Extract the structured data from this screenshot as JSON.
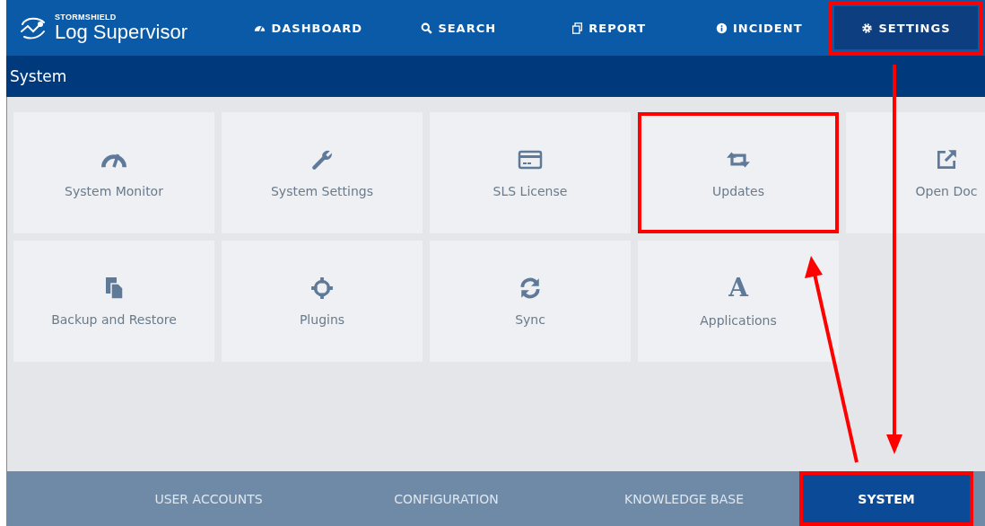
{
  "logo": {
    "brand": "STORMSHIELD",
    "product": "Log Supervisor"
  },
  "nav": [
    {
      "label": "DASHBOARD",
      "selected": false,
      "highlighted": false
    },
    {
      "label": "SEARCH",
      "selected": false,
      "highlighted": false
    },
    {
      "label": "REPORT",
      "selected": false,
      "highlighted": false
    },
    {
      "label": "INCIDENT",
      "selected": false,
      "highlighted": false
    },
    {
      "label": "SETTINGS",
      "selected": true,
      "highlighted": true
    }
  ],
  "section_title": "System",
  "tiles": [
    {
      "label": "System Monitor",
      "highlighted": false
    },
    {
      "label": "System Settings",
      "highlighted": false
    },
    {
      "label": "SLS License",
      "highlighted": false
    },
    {
      "label": "Updates",
      "highlighted": true
    },
    {
      "label": "Open Doc",
      "highlighted": false
    },
    {
      "label": "Backup and Restore",
      "highlighted": false
    },
    {
      "label": "Plugins",
      "highlighted": false
    },
    {
      "label": "Sync",
      "highlighted": false
    },
    {
      "label": "Applications",
      "glyph": "A",
      "highlighted": false
    }
  ],
  "bottom_tabs": [
    {
      "label": "USER ACCOUNTS",
      "selected": false,
      "highlighted": false
    },
    {
      "label": "CONFIGURATION",
      "selected": false,
      "highlighted": false
    },
    {
      "label": "KNOWLEDGE BASE",
      "selected": false,
      "highlighted": false
    },
    {
      "label": "SYSTEM",
      "selected": true,
      "highlighted": true
    }
  ]
}
